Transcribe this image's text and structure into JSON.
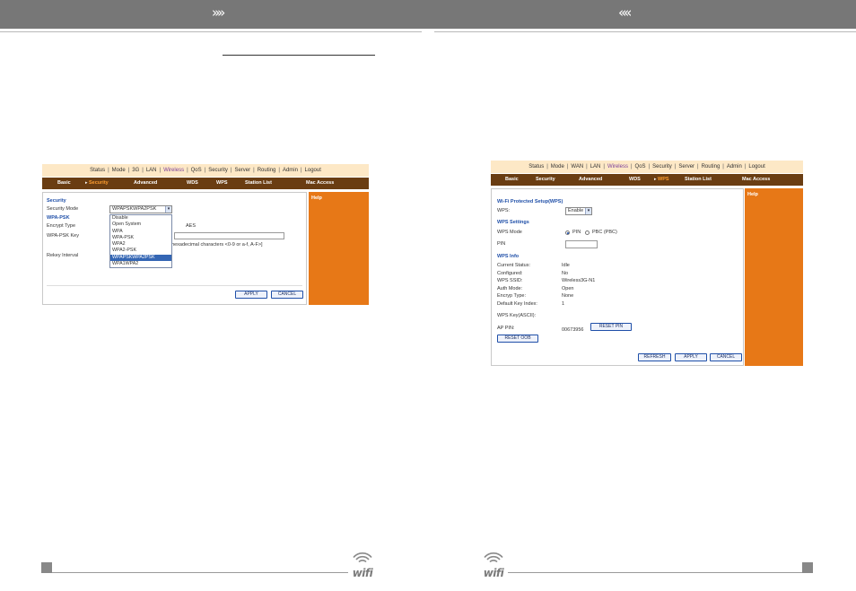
{
  "header": {
    "left_arrows": "»»",
    "right_arrows": "««"
  },
  "left_panel": {
    "nav1": [
      {
        "label": "Status",
        "active": false
      },
      {
        "label": "Mode",
        "active": false
      },
      {
        "label": "3G",
        "active": false
      },
      {
        "label": "LAN",
        "active": false
      },
      {
        "label": "Wireless",
        "active": true
      },
      {
        "label": "QoS",
        "active": false
      },
      {
        "label": "Security",
        "active": false
      },
      {
        "label": "Server",
        "active": false
      },
      {
        "label": "Routing",
        "active": false
      },
      {
        "label": "Admin",
        "active": false
      },
      {
        "label": "Logout",
        "active": false
      }
    ],
    "nav2": [
      {
        "label": "Basic",
        "active": false
      },
      {
        "label": "Security",
        "active": true
      },
      {
        "label": "Advanced",
        "active": false
      },
      {
        "label": "WDS",
        "active": false
      },
      {
        "label": "WPS",
        "active": false
      },
      {
        "label": "Station List",
        "active": false
      },
      {
        "label": "Mac Access",
        "active": false
      }
    ],
    "section_title": "Security",
    "security_mode_label": "Security Mode",
    "security_mode_value": "WPAPSKWPA2PSK",
    "wpapsk_title": "WPA-PSK",
    "encrypt_type_label": "Encrypt Type",
    "encrypt_type_value": "AES",
    "wpapsk_key_label": "WPA-PSK Key",
    "key_hint": "or 64 hexadecimal characters <0-9 or a-f, A-F>]",
    "rekey_label": "Rekey Interval",
    "dropdown_options": [
      "Disable",
      "Open System",
      "WPA",
      "WPA-PSK",
      "WPA2",
      "WPA2-PSK",
      "WPAPSKWPA2PSK",
      "WPA1WPA2"
    ],
    "dropdown_selected": "WPAPSKWPA2PSK",
    "apply_label": "APPLY",
    "cancel_label": "CANCEL",
    "help_label": "Help"
  },
  "right_panel": {
    "nav1": [
      {
        "label": "Status",
        "active": false
      },
      {
        "label": "Mode",
        "active": false
      },
      {
        "label": "WAN",
        "active": false
      },
      {
        "label": "LAN",
        "active": false
      },
      {
        "label": "Wireless",
        "active": true
      },
      {
        "label": "QoS",
        "active": false
      },
      {
        "label": "Security",
        "active": false
      },
      {
        "label": "Server",
        "active": false
      },
      {
        "label": "Routing",
        "active": false
      },
      {
        "label": "Admin",
        "active": false
      },
      {
        "label": "Logout",
        "active": false
      }
    ],
    "nav2": [
      {
        "label": "Basic",
        "active": false
      },
      {
        "label": "Security",
        "active": false
      },
      {
        "label": "Advanced",
        "active": false
      },
      {
        "label": "WDS",
        "active": false
      },
      {
        "label": "WPS",
        "active": true
      },
      {
        "label": "Station List",
        "active": false
      },
      {
        "label": "Mac Access",
        "active": false
      }
    ],
    "wps_title": "Wi-Fi Protected Setup(WPS)",
    "wps_label": "WPS:",
    "wps_value": "Enable",
    "settings_title": "WPS Settings",
    "wps_mode_label": "WPS Mode",
    "pin_option": "PIN",
    "pbc_option": "PBC (PBC)",
    "pin_label": "PIN",
    "info_title": "WPS Info",
    "info_rows": [
      {
        "label": "Current Status:",
        "value": "Idle"
      },
      {
        "label": "Configured:",
        "value": "No"
      },
      {
        "label": "WPS SSID:",
        "value": "Wireless3G-N1"
      },
      {
        "label": "Auth Mode:",
        "value": "Open"
      },
      {
        "label": "Encryp Type:",
        "value": "None"
      },
      {
        "label": "Default Key Index:",
        "value": "1"
      }
    ],
    "wps_key_label": "WPS Key(ASCII):",
    "ap_pin_label": "AP PIN:",
    "ap_pin_value": "00673956",
    "reset_pin_label": "RESET PIN",
    "reset_oob_label": "RESET OOB",
    "refresh_label": "REFRESH",
    "apply_label": "APPLY",
    "cancel_label": "CANCEL",
    "help_label": "Help"
  },
  "footer": {
    "logo_text": "wifi"
  }
}
